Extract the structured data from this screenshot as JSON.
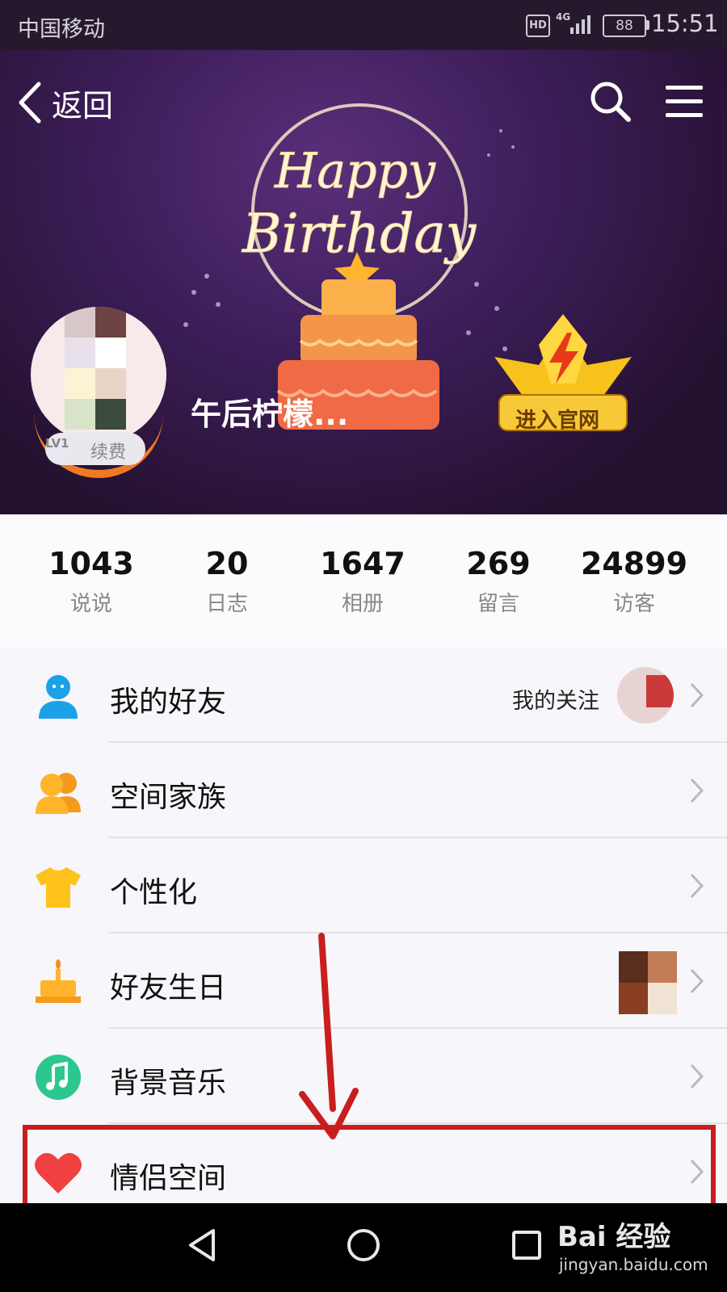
{
  "status_bar": {
    "carrier": "中国移动",
    "hd": "HD",
    "network": "4G",
    "battery": "88",
    "time": "15:51"
  },
  "header": {
    "back_label": "返回",
    "search_icon": "search-icon",
    "menu_icon": "hamburger-menu-icon"
  },
  "banner": {
    "theme": "Happy Birthday cake",
    "username": "午后柠檬...",
    "level": "LV1",
    "renew_label": "续费",
    "official_site_label": "进入官网"
  },
  "stats": [
    {
      "value": "1043",
      "label": "说说"
    },
    {
      "value": "20",
      "label": "日志"
    },
    {
      "value": "1647",
      "label": "相册"
    },
    {
      "value": "269",
      "label": "留言"
    },
    {
      "value": "24899",
      "label": "访客"
    }
  ],
  "menu": [
    {
      "label": "我的好友",
      "icon": "friend-icon",
      "extra": "我的关注"
    },
    {
      "label": "空间家族",
      "icon": "family-icon"
    },
    {
      "label": "个性化",
      "icon": "tshirt-icon"
    },
    {
      "label": "好友生日",
      "icon": "birthday-cake-icon"
    },
    {
      "label": "背景音乐",
      "icon": "music-note-icon"
    },
    {
      "label": "情侣空间",
      "icon": "heart-icon"
    }
  ],
  "watermark": {
    "logo": "Bai 经验",
    "url": "jingyan.baidu.com"
  },
  "colors": {
    "highlight": "#c91e1e",
    "accent_blue": "#1aa1e8",
    "accent_orange": "#ffa619",
    "music_green": "#2cc78e",
    "heart_red": "#f04040"
  }
}
